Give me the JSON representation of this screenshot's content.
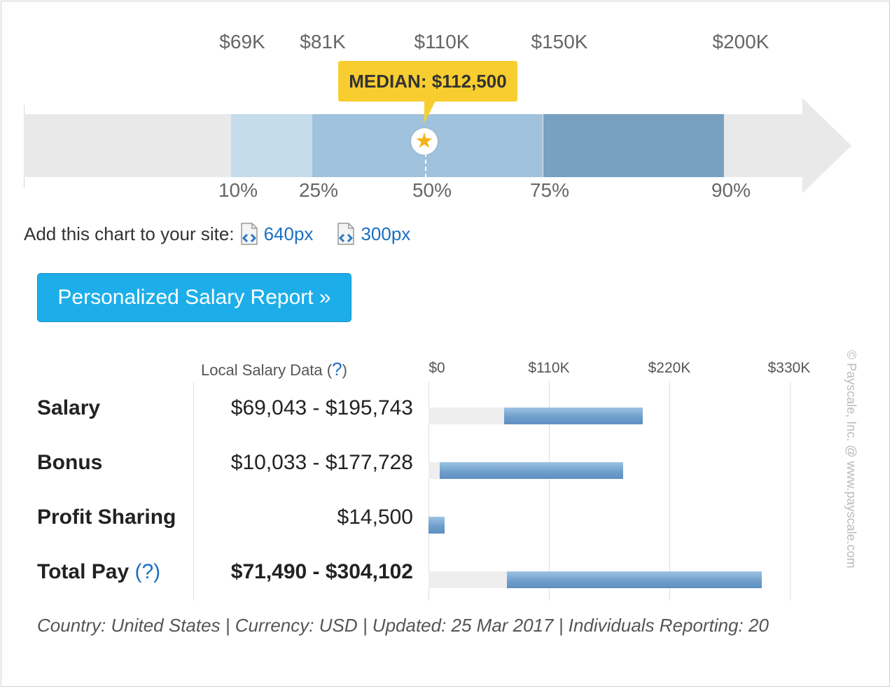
{
  "chart_data": [
    {
      "type": "bar",
      "percentile_values": [
        "$69K",
        "$81K",
        "$110K",
        "$150K",
        "$200K"
      ],
      "percentile_labels": [
        "10%",
        "25%",
        "50%",
        "75%",
        "90%"
      ],
      "median_label": "MEDIAN: $112,500",
      "median_value": 112500,
      "colors": [
        "#c5dcec",
        "#a1c2dc",
        "#a1c2dc",
        "#78a1c1"
      ]
    },
    {
      "type": "bar",
      "xlim": [
        0,
        330000
      ],
      "ticks": [
        "$0",
        "$110K",
        "$220K",
        "$330K"
      ],
      "tick_values": [
        0,
        110000,
        220000,
        330000
      ],
      "column_header": "Local Salary Data (",
      "rows": [
        {
          "label": "Salary",
          "range": "$69,043 - $195,743",
          "low": 69043,
          "high": 195743,
          "bold": false,
          "help": ""
        },
        {
          "label": "Bonus",
          "range": "$10,033 - $177,728",
          "low": 10033,
          "high": 177728,
          "bold": false,
          "help": ""
        },
        {
          "label": "Profit Sharing",
          "range": "$14,500",
          "low": 0,
          "high": 14500,
          "bold": false,
          "help": ""
        },
        {
          "label": "Total Pay",
          "range": "$71,490 - $304,102",
          "low": 71490,
          "high": 304102,
          "bold": true,
          "help": "?"
        }
      ]
    }
  ],
  "embed": {
    "label": "Add this chart to your site:",
    "link1": "640px",
    "link2": "300px"
  },
  "cta": {
    "label": "Personalized Salary Report »"
  },
  "footer": "Country: United States | Currency: USD | Updated: 25 Mar 2017 | Individuals Reporting: 20",
  "copyright": "© Payscale, Inc. @ www.payscale.com",
  "help_symbol": "?",
  "icons": {
    "star": "star-icon",
    "embed": "embed-code-icon"
  }
}
